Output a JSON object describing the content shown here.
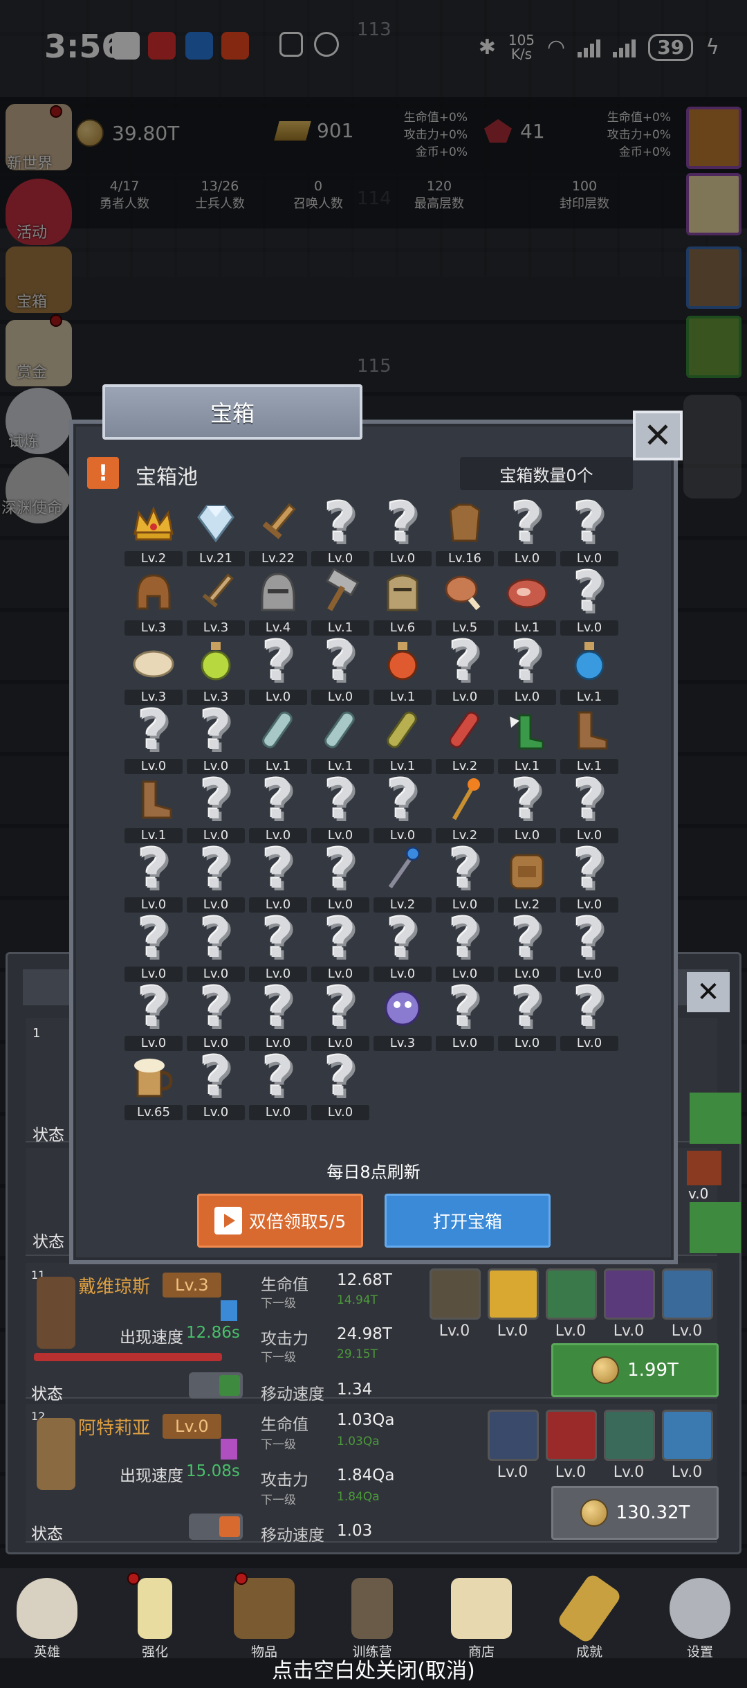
{
  "status_bar": {
    "time": "3:56",
    "net_speed": "105",
    "net_unit": "K/s",
    "battery": "39"
  },
  "floors": {
    "f113": "113",
    "f114": "114",
    "f115": "115"
  },
  "resources": {
    "gold": "39.80T",
    "bars": "901",
    "gems": "41",
    "bonus_left": [
      "生命值+0%",
      "攻击力+0%",
      "金币+0%"
    ],
    "bonus_right": [
      "生命值+0%",
      "攻击力+0%",
      "金币+0%"
    ]
  },
  "counters": [
    {
      "value": "4/17",
      "label": "勇者人数"
    },
    {
      "value": "13/26",
      "label": "士兵人数"
    },
    {
      "value": "0",
      "label": "召唤人数"
    },
    {
      "value": "120",
      "label": "最高层数"
    },
    {
      "value": "100",
      "label": "封印层数"
    }
  ],
  "side_menu": [
    "新世界",
    "活动",
    "宝箱",
    "赏金",
    "试炼",
    "深渊使命"
  ],
  "modal": {
    "tab_title": "宝箱",
    "pool_title": "宝箱池",
    "chest_count": "宝箱数量0个",
    "refresh_note": "每日8点刷新",
    "double_btn": "双倍领取5/5",
    "open_btn": "打开宝箱",
    "close_icon": "close-icon"
  },
  "items": [
    {
      "icon": "crown",
      "lv": "Lv.2"
    },
    {
      "icon": "diamond",
      "lv": "Lv.21"
    },
    {
      "icon": "wooden-sword",
      "lv": "Lv.22"
    },
    {
      "icon": "unknown",
      "lv": "Lv.0"
    },
    {
      "icon": "unknown",
      "lv": "Lv.0"
    },
    {
      "icon": "leather-armor",
      "lv": "Lv.16"
    },
    {
      "icon": "unknown",
      "lv": "Lv.0"
    },
    {
      "icon": "unknown",
      "lv": "Lv.0"
    },
    {
      "icon": "leather-helmet",
      "lv": "Lv.3"
    },
    {
      "icon": "dagger",
      "lv": "Lv.3"
    },
    {
      "icon": "iron-helmet",
      "lv": "Lv.4"
    },
    {
      "icon": "hammer",
      "lv": "Lv.1"
    },
    {
      "icon": "knight-helmet",
      "lv": "Lv.6"
    },
    {
      "icon": "drumstick",
      "lv": "Lv.5"
    },
    {
      "icon": "steak",
      "lv": "Lv.1"
    },
    {
      "icon": "unknown",
      "lv": "Lv.0"
    },
    {
      "icon": "bread",
      "lv": "Lv.3"
    },
    {
      "icon": "green-potion",
      "lv": "Lv.3"
    },
    {
      "icon": "unknown",
      "lv": "Lv.0"
    },
    {
      "icon": "unknown",
      "lv": "Lv.0"
    },
    {
      "icon": "red-potion",
      "lv": "Lv.1"
    },
    {
      "icon": "unknown",
      "lv": "Lv.0"
    },
    {
      "icon": "unknown",
      "lv": "Lv.0"
    },
    {
      "icon": "blue-potion",
      "lv": "Lv.1"
    },
    {
      "icon": "unknown",
      "lv": "Lv.0"
    },
    {
      "icon": "unknown",
      "lv": "Lv.0"
    },
    {
      "icon": "glass-bottle",
      "lv": "Lv.1"
    },
    {
      "icon": "glass-bottle",
      "lv": "Lv.1"
    },
    {
      "icon": "olive-bottle",
      "lv": "Lv.1"
    },
    {
      "icon": "red-bottle",
      "lv": "Lv.2"
    },
    {
      "icon": "winged-boot",
      "lv": "Lv.1"
    },
    {
      "icon": "leather-boot",
      "lv": "Lv.1"
    },
    {
      "icon": "leather-boot",
      "lv": "Lv.1"
    },
    {
      "icon": "unknown",
      "lv": "Lv.0"
    },
    {
      "icon": "unknown",
      "lv": "Lv.0"
    },
    {
      "icon": "unknown",
      "lv": "Lv.0"
    },
    {
      "icon": "unknown",
      "lv": "Lv.0"
    },
    {
      "icon": "fire-staff",
      "lv": "Lv.2"
    },
    {
      "icon": "unknown",
      "lv": "Lv.0"
    },
    {
      "icon": "unknown",
      "lv": "Lv.0"
    },
    {
      "icon": "unknown",
      "lv": "Lv.0"
    },
    {
      "icon": "unknown",
      "lv": "Lv.0"
    },
    {
      "icon": "unknown",
      "lv": "Lv.0"
    },
    {
      "icon": "unknown",
      "lv": "Lv.0"
    },
    {
      "icon": "blue-scepter",
      "lv": "Lv.2"
    },
    {
      "icon": "unknown",
      "lv": "Lv.0"
    },
    {
      "icon": "backpack",
      "lv": "Lv.2"
    },
    {
      "icon": "unknown",
      "lv": "Lv.0"
    },
    {
      "icon": "unknown",
      "lv": "Lv.0"
    },
    {
      "icon": "unknown",
      "lv": "Lv.0"
    },
    {
      "icon": "unknown",
      "lv": "Lv.0"
    },
    {
      "icon": "unknown",
      "lv": "Lv.0"
    },
    {
      "icon": "unknown",
      "lv": "Lv.0"
    },
    {
      "icon": "unknown",
      "lv": "Lv.0"
    },
    {
      "icon": "unknown",
      "lv": "Lv.0"
    },
    {
      "icon": "unknown",
      "lv": "Lv.0"
    },
    {
      "icon": "unknown",
      "lv": "Lv.0"
    },
    {
      "icon": "unknown",
      "lv": "Lv.0"
    },
    {
      "icon": "unknown",
      "lv": "Lv.0"
    },
    {
      "icon": "unknown",
      "lv": "Lv.0"
    },
    {
      "icon": "spirit-creature",
      "lv": "Lv.3"
    },
    {
      "icon": "unknown",
      "lv": "Lv.0"
    },
    {
      "icon": "unknown",
      "lv": "Lv.0"
    },
    {
      "icon": "unknown",
      "lv": "Lv.0"
    },
    {
      "icon": "beer-mug",
      "lv": "Lv.65"
    },
    {
      "icon": "unknown",
      "lv": "Lv.0"
    },
    {
      "icon": "unknown",
      "lv": "Lv.0"
    },
    {
      "icon": "unknown",
      "lv": "Lv.0"
    }
  ],
  "heroes_bg": {
    "row1": {
      "index": "1",
      "status": "状态"
    },
    "row2": {
      "status": "状态",
      "lv": "v.0"
    },
    "hero11": {
      "index": "11",
      "name": "戴维琼斯",
      "level": "Lv.3",
      "speed_label": "出现速度",
      "speed": "12.86s",
      "hp_label": "生命值",
      "hp": "12.68T",
      "hp_next_label": "下一级",
      "hp_next": "14.94T",
      "atk_label": "攻击力",
      "atk": "24.98T",
      "atk_next_label": "下一级",
      "atk_next": "29.15T",
      "move_label": "移动速度",
      "move": "1.34",
      "status": "状态",
      "skills": [
        "Lv.0",
        "Lv.0",
        "Lv.0",
        "Lv.0",
        "Lv.0"
      ],
      "cost": "1.99T"
    },
    "hero12": {
      "index": "12",
      "name": "阿特莉亚",
      "level": "Lv.0",
      "speed_label": "出现速度",
      "speed": "15.08s",
      "hp_label": "生命值",
      "hp": "1.03Qa",
      "hp_next_label": "下一级",
      "hp_next": "1.03Qa",
      "atk_label": "攻击力",
      "atk": "1.84Qa",
      "atk_next_label": "下一级",
      "atk_next": "1.84Qa",
      "move_label": "移动速度",
      "move": "1.03",
      "status": "状态",
      "skills": [
        "Lv.0",
        "Lv.0",
        "Lv.0",
        "Lv.0"
      ],
      "cost": "130.32T"
    }
  },
  "nav": [
    "英雄",
    "强化",
    "物品",
    "训练营",
    "商店",
    "成就",
    "设置"
  ],
  "close_hint": "点击空白处关闭(取消)",
  "colors": {
    "orange": "#d86a30",
    "blue": "#3a8ad8",
    "green": "#3e8a3e",
    "level_orange": "#8c5a2a"
  }
}
